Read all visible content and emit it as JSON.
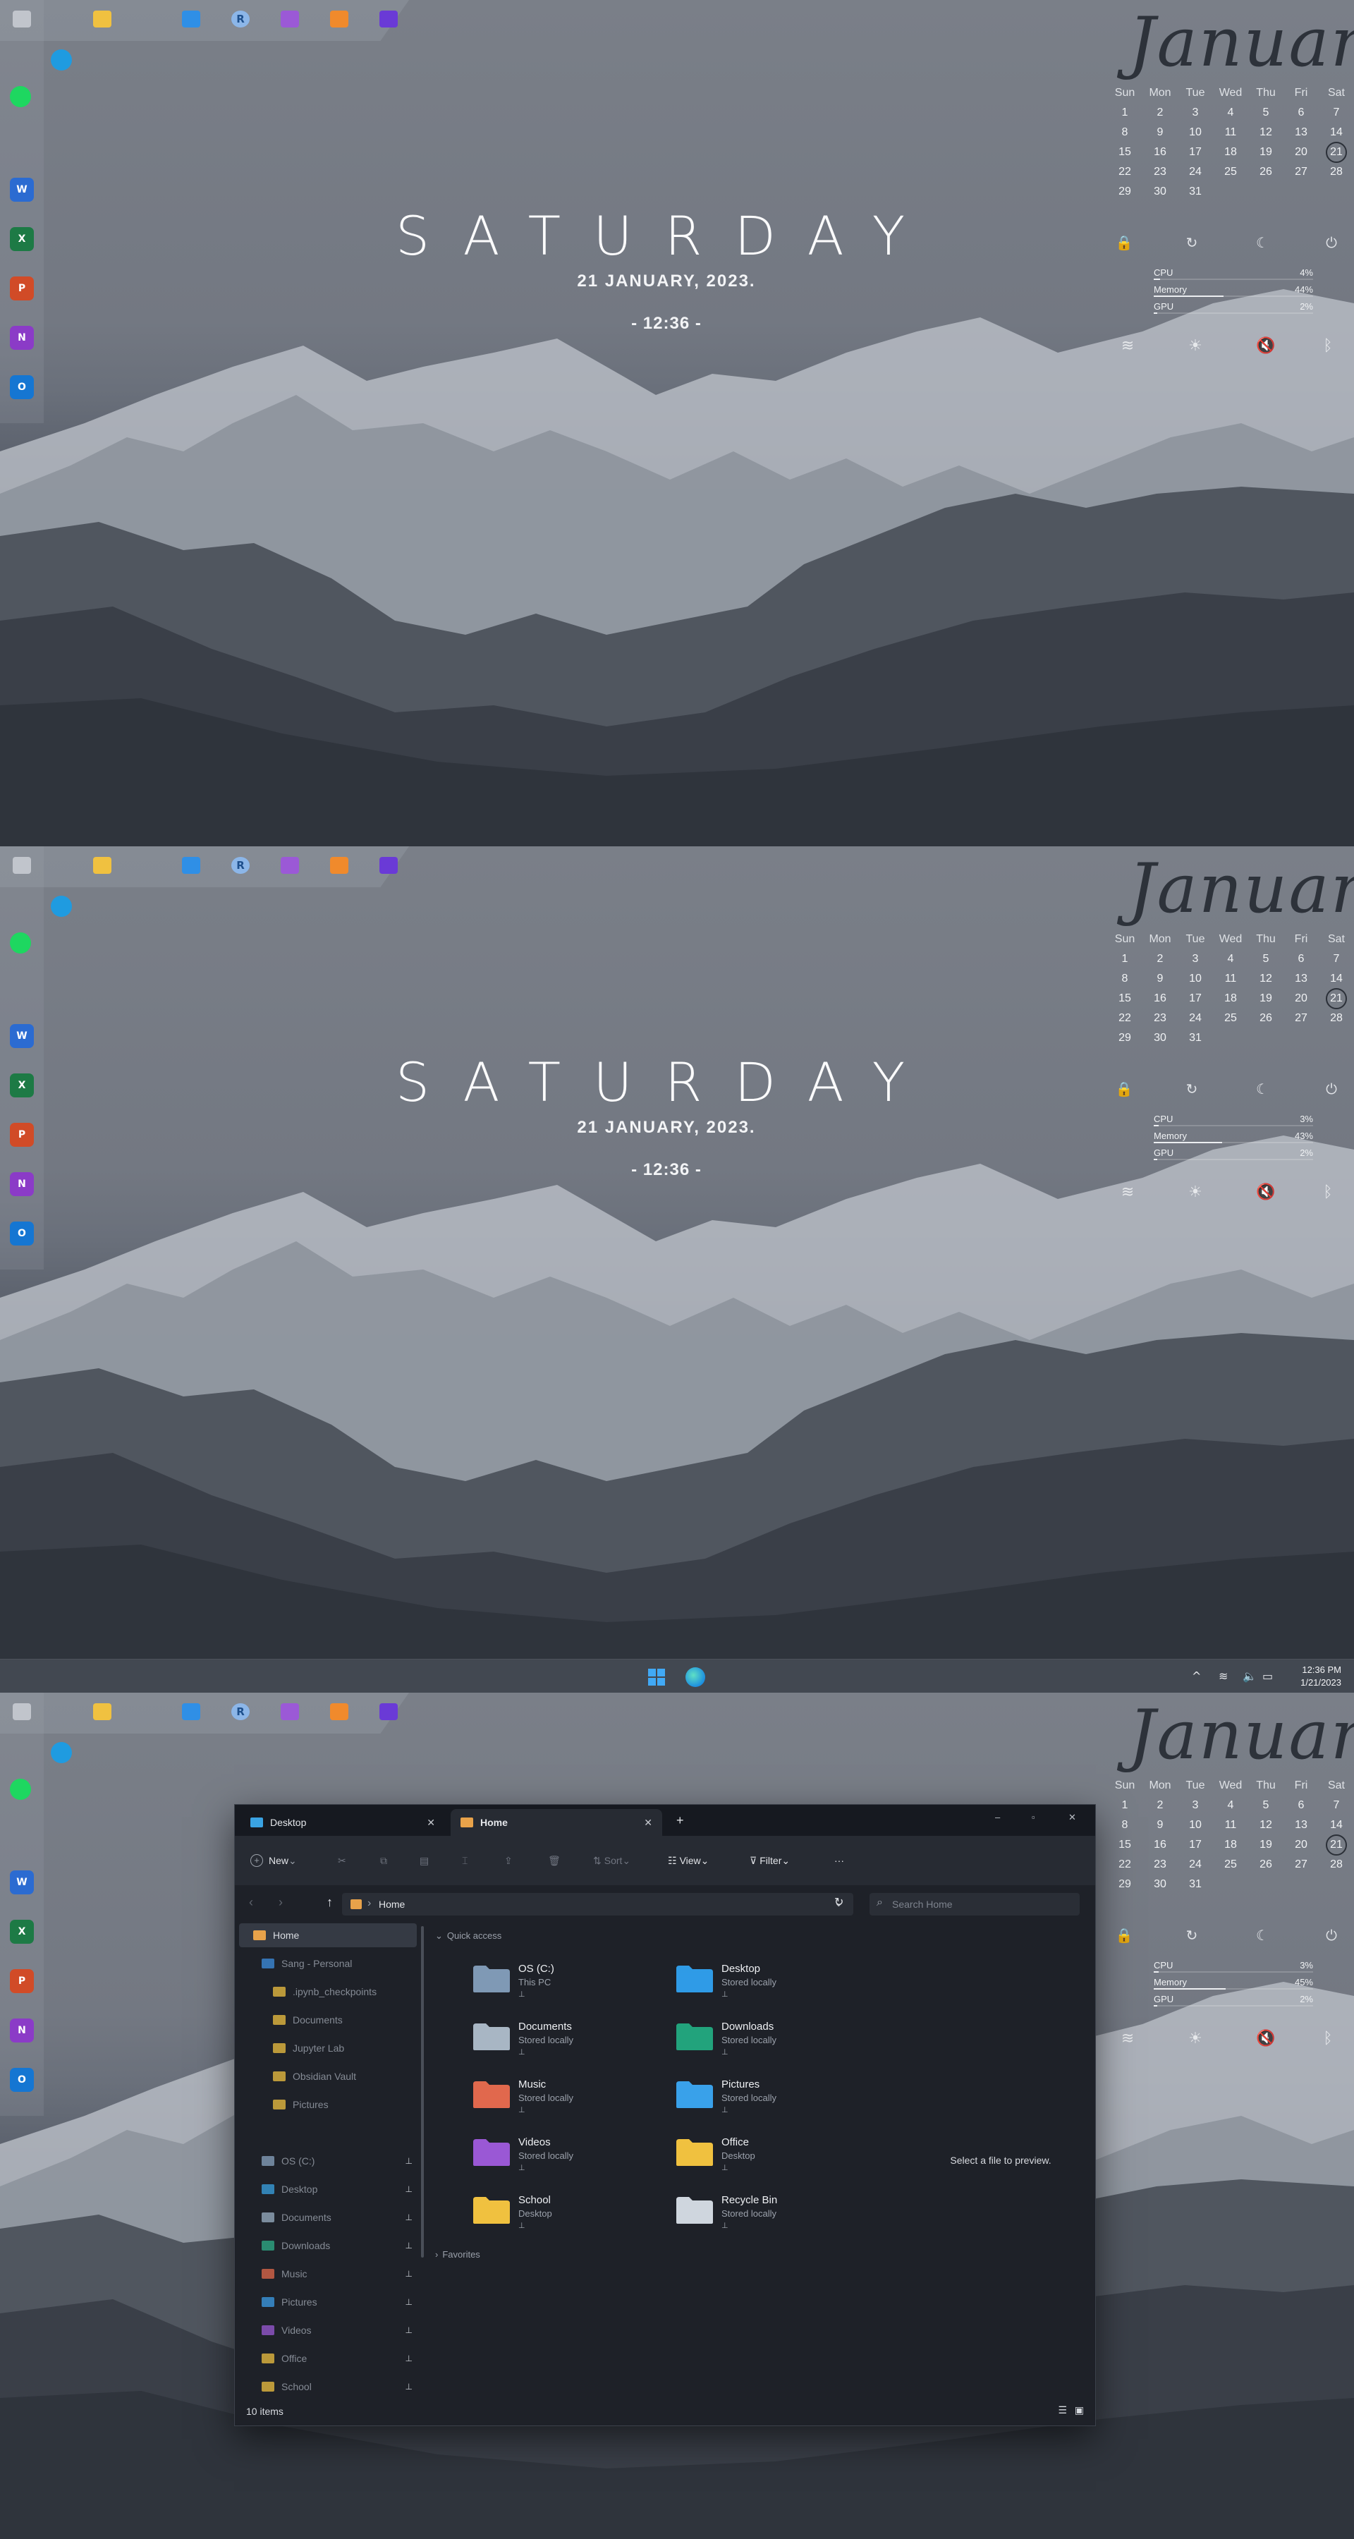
{
  "launcher": {
    "apps": [
      {
        "name": "Recycle Bin",
        "icon": "recycle-bin-icon"
      },
      {
        "name": "File Explorer",
        "icon": "folder-icon"
      },
      {
        "name": "Visual Studio Code",
        "icon": "vscode-icon"
      },
      {
        "name": "R",
        "icon": "r-icon",
        "glyph": "R"
      },
      {
        "name": "Visual Studio",
        "icon": "visual-studio-icon"
      },
      {
        "name": "Sublime",
        "icon": "square-app-icon"
      },
      {
        "name": "Obsidian",
        "icon": "obsidian-icon"
      }
    ]
  },
  "dock": {
    "apps": [
      {
        "icon": "edge-icon",
        "glyph": "",
        "color": "#1f9be0"
      },
      {
        "icon": "spotify-icon",
        "glyph": "",
        "color": "#1ed760"
      },
      {
        "icon": "word-icon",
        "glyph": "W",
        "color": "#2b6bd1"
      },
      {
        "icon": "excel-icon",
        "glyph": "X",
        "color": "#1d7a45"
      },
      {
        "icon": "powerpoint-icon",
        "glyph": "P",
        "color": "#d14b27"
      },
      {
        "icon": "onenote-icon",
        "glyph": "N",
        "color": "#8b3bc7"
      },
      {
        "icon": "outlook-icon",
        "glyph": "O",
        "color": "#1576d2"
      }
    ]
  },
  "clock_widget": {
    "day": "SATURDAY",
    "date": "21 JANUARY, 2023.",
    "time": "- 12:36 -"
  },
  "calendar": {
    "month": "January",
    "weekdays": [
      "Sun",
      "Mon",
      "Tue",
      "Wed",
      "Thu",
      "Fri",
      "Sat"
    ],
    "weeks": [
      [
        "1",
        "2",
        "3",
        "4",
        "5",
        "6",
        "7"
      ],
      [
        "8",
        "9",
        "10",
        "11",
        "12",
        "13",
        "14"
      ],
      [
        "15",
        "16",
        "17",
        "18",
        "19",
        "20",
        "21"
      ],
      [
        "22",
        "23",
        "24",
        "25",
        "26",
        "27",
        "28"
      ],
      [
        "29",
        "30",
        "31",
        "",
        "",
        "",
        ""
      ]
    ],
    "today": "21"
  },
  "power_buttons": [
    {
      "icon": "lock-icon",
      "glyph": "🔒"
    },
    {
      "icon": "restart-icon",
      "glyph": "↻"
    },
    {
      "icon": "sleep-icon",
      "glyph": "☾"
    },
    {
      "icon": "power-icon",
      "glyph": "⏻"
    }
  ],
  "stats_panels": [
    {
      "cpu_label": "CPU",
      "cpu": "4%",
      "cpu_level": 0.04,
      "mem_label": "Memory",
      "mem": "44%",
      "mem_level": 0.44,
      "gpu_label": "GPU",
      "gpu": "2%",
      "gpu_level": 0.02
    },
    {
      "cpu_label": "CPU",
      "cpu": "3%",
      "cpu_level": 0.03,
      "mem_label": "Memory",
      "mem": "43%",
      "mem_level": 0.43,
      "gpu_label": "GPU",
      "gpu": "2%",
      "gpu_level": 0.02
    },
    {
      "cpu_label": "CPU",
      "cpu": "3%",
      "cpu_level": 0.03,
      "mem_label": "Memory",
      "mem": "45%",
      "mem_level": 0.45,
      "gpu_label": "GPU",
      "gpu": "2%",
      "gpu_level": 0.02
    }
  ],
  "quick_settings": [
    {
      "icon": "wifi-icon",
      "glyph": "≋"
    },
    {
      "icon": "brightness-icon",
      "glyph": "☀"
    },
    {
      "icon": "mute-icon",
      "glyph": "🔇"
    },
    {
      "icon": "bluetooth-icon",
      "glyph": "ᛒ"
    }
  ],
  "taskbar": {
    "time": "12:36 PM",
    "date": "1/21/2023",
    "tray": [
      {
        "icon": "chevron-up-icon",
        "glyph": "^"
      },
      {
        "icon": "wifi-icon",
        "glyph": "≋"
      },
      {
        "icon": "volume-icon",
        "glyph": "🔈"
      },
      {
        "icon": "battery-icon",
        "glyph": "▭"
      }
    ]
  },
  "explorer": {
    "tabs": [
      {
        "label": "Desktop",
        "active": false
      },
      {
        "label": "Home",
        "active": true
      }
    ],
    "new_tab": "+",
    "window_controls": {
      "minimize": "–",
      "maximize": "▫",
      "close": "✕"
    },
    "toolbar": {
      "new": "New",
      "sort": "Sort",
      "view": "View",
      "filter": "Filter",
      "more": "···"
    },
    "address": {
      "crumb": "Home",
      "search_placeholder": "Search Home"
    },
    "nav": [
      {
        "label": "Home",
        "icon": "home-icon",
        "color": "#e8a24a",
        "selected": true,
        "indent": 0,
        "pinned": false
      },
      {
        "label": "Sang - Personal",
        "icon": "onedrive-icon",
        "color": "#3d8fe0",
        "selected": false,
        "indent": 1,
        "pinned": false,
        "dim": true
      },
      {
        "label": ".ipynb_checkpoints",
        "icon": "folder-icon",
        "color": "#f0c140",
        "selected": false,
        "indent": 2,
        "pinned": false,
        "dim": true
      },
      {
        "label": "Documents",
        "icon": "folder-icon",
        "color": "#f0c140",
        "selected": false,
        "indent": 2,
        "pinned": false,
        "dim": true
      },
      {
        "label": "Jupyter Lab",
        "icon": "folder-icon",
        "color": "#f0c140",
        "selected": false,
        "indent": 2,
        "pinned": false,
        "dim": true
      },
      {
        "label": "Obsidian Vault",
        "icon": "folder-icon",
        "color": "#f0c140",
        "selected": false,
        "indent": 2,
        "pinned": false,
        "dim": true
      },
      {
        "label": "Pictures",
        "icon": "folder-icon",
        "color": "#f0c140",
        "selected": false,
        "indent": 2,
        "pinned": false,
        "dim": true
      },
      {
        "label": "OS (C:)",
        "icon": "drive-icon",
        "color": "#8aa4c0",
        "selected": false,
        "indent": 1,
        "pinned": true,
        "dim": true
      },
      {
        "label": "Desktop",
        "icon": "desktop-icon",
        "color": "#3aa3e3",
        "selected": false,
        "indent": 1,
        "pinned": true,
        "dim": true
      },
      {
        "label": "Documents",
        "icon": "documents-icon",
        "color": "#9bb0c4",
        "selected": false,
        "indent": 1,
        "pinned": true,
        "dim": true
      },
      {
        "label": "Downloads",
        "icon": "downloads-icon",
        "color": "#2fb08a",
        "selected": false,
        "indent": 1,
        "pinned": true,
        "dim": true
      },
      {
        "label": "Music",
        "icon": "music-icon",
        "color": "#e46a4b",
        "selected": false,
        "indent": 1,
        "pinned": true,
        "dim": true
      },
      {
        "label": "Pictures",
        "icon": "pictures-icon",
        "color": "#3c9ee8",
        "selected": false,
        "indent": 1,
        "pinned": true,
        "dim": true
      },
      {
        "label": "Videos",
        "icon": "videos-icon",
        "color": "#9b59d6",
        "selected": false,
        "indent": 1,
        "pinned": true,
        "dim": true
      },
      {
        "label": "Office",
        "icon": "folder-icon",
        "color": "#f0c140",
        "selected": false,
        "indent": 1,
        "pinned": true,
        "dim": true
      },
      {
        "label": "School",
        "icon": "folder-icon",
        "color": "#f0c140",
        "selected": false,
        "indent": 1,
        "pinned": true,
        "dim": true
      }
    ],
    "quick_access_label": "Quick access",
    "favorites_label": "Favorites",
    "quick_access": [
      {
        "name": "OS (C:)",
        "sub": "This PC",
        "icon": "drive-icon",
        "color": "#7f99b5"
      },
      {
        "name": "Desktop",
        "sub": "Stored locally",
        "icon": "desktop-folder-icon",
        "color": "#2f9be6"
      },
      {
        "name": "Documents",
        "sub": "Stored locally",
        "icon": "documents-folder-icon",
        "color": "#a8b6c4"
      },
      {
        "name": "Downloads",
        "sub": "Stored locally",
        "icon": "downloads-folder-icon",
        "color": "#22a37c"
      },
      {
        "name": "Music",
        "sub": "Stored locally",
        "icon": "music-folder-icon",
        "color": "#e0694d"
      },
      {
        "name": "Pictures",
        "sub": "Stored locally",
        "icon": "pictures-folder-icon",
        "color": "#3aa1ea"
      },
      {
        "name": "Videos",
        "sub": "Stored locally",
        "icon": "videos-folder-icon",
        "color": "#9a58d5"
      },
      {
        "name": "Office",
        "sub": "Desktop",
        "icon": "folder-icon",
        "color": "#f0c140"
      },
      {
        "name": "School",
        "sub": "Desktop",
        "icon": "folder-icon",
        "color": "#f0c140"
      },
      {
        "name": "Recycle Bin",
        "sub": "Stored locally",
        "icon": "recycle-bin-icon",
        "color": "#cfd6de"
      }
    ],
    "pin_glyph": "📌",
    "preview_text": "Select a file to preview.",
    "status": "10 items"
  }
}
